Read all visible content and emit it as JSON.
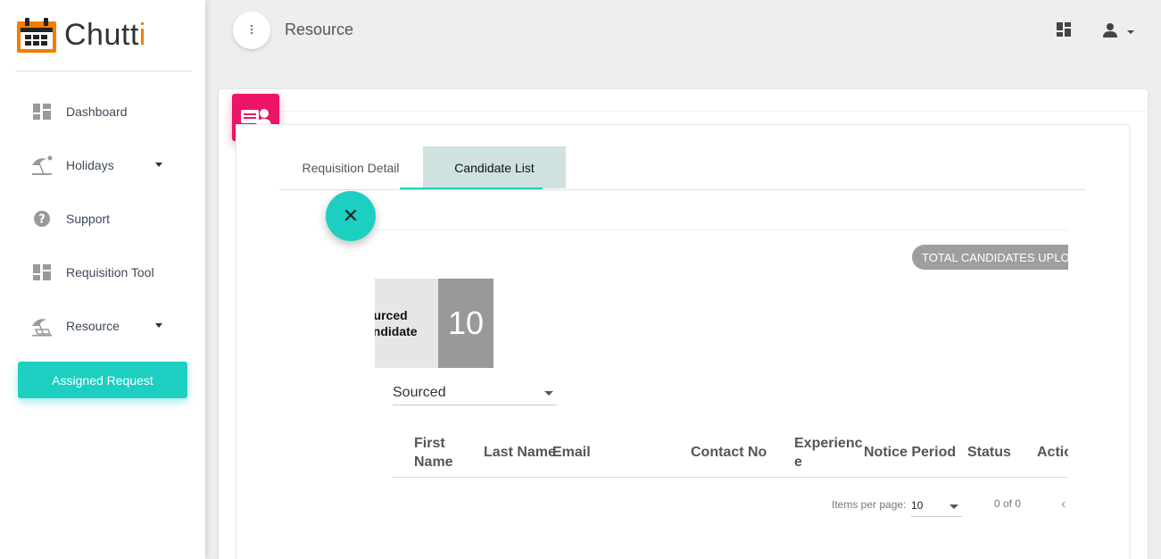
{
  "app": {
    "name_main": "Chutt",
    "name_accent": "i",
    "brand_color": "#f57c00",
    "accent_color": "#1dcfc0"
  },
  "sidebar": {
    "items": [
      {
        "label": "Dashboard",
        "icon": "dashboard-icon"
      },
      {
        "label": "Holidays",
        "icon": "beach-icon",
        "has_caret": true
      },
      {
        "label": "Support",
        "icon": "help-icon"
      },
      {
        "label": "Requisition Tool",
        "icon": "dashboard-icon"
      },
      {
        "label": "Resource",
        "icon": "beach-icon",
        "has_caret": true
      }
    ],
    "active_item": {
      "label": "Assigned Request"
    }
  },
  "header": {
    "menu_icon": "more-vert-icon",
    "title": "Resource",
    "right_icons": [
      "dashboard-icon",
      "person-icon"
    ]
  },
  "card": {
    "icon": "resource-card-icon",
    "tabs": [
      {
        "label": "Requisition Detail",
        "active": false
      },
      {
        "label": "Candidate List",
        "active": true
      }
    ],
    "fab_label": "✕",
    "total_badge": "TOTAL CANDIDATES UPLO",
    "stat": {
      "label_line1": "ourced",
      "label_line2": "andidate",
      "value": "10"
    },
    "filter": {
      "value": "Sourced"
    },
    "table": {
      "headers": [
        "First Name",
        "Last Name",
        "Email",
        "Contact No",
        "Experience",
        "Notice Period",
        "Status",
        "Actio"
      ],
      "header_first_l1": "First",
      "header_first_l2": "Name",
      "header_exp_l1": "Experienc",
      "header_exp_l2": "e"
    },
    "paginator": {
      "items_per_page_label": "Items per page:",
      "page_size": "10",
      "range": "0 of 0",
      "prev": "‹"
    }
  }
}
